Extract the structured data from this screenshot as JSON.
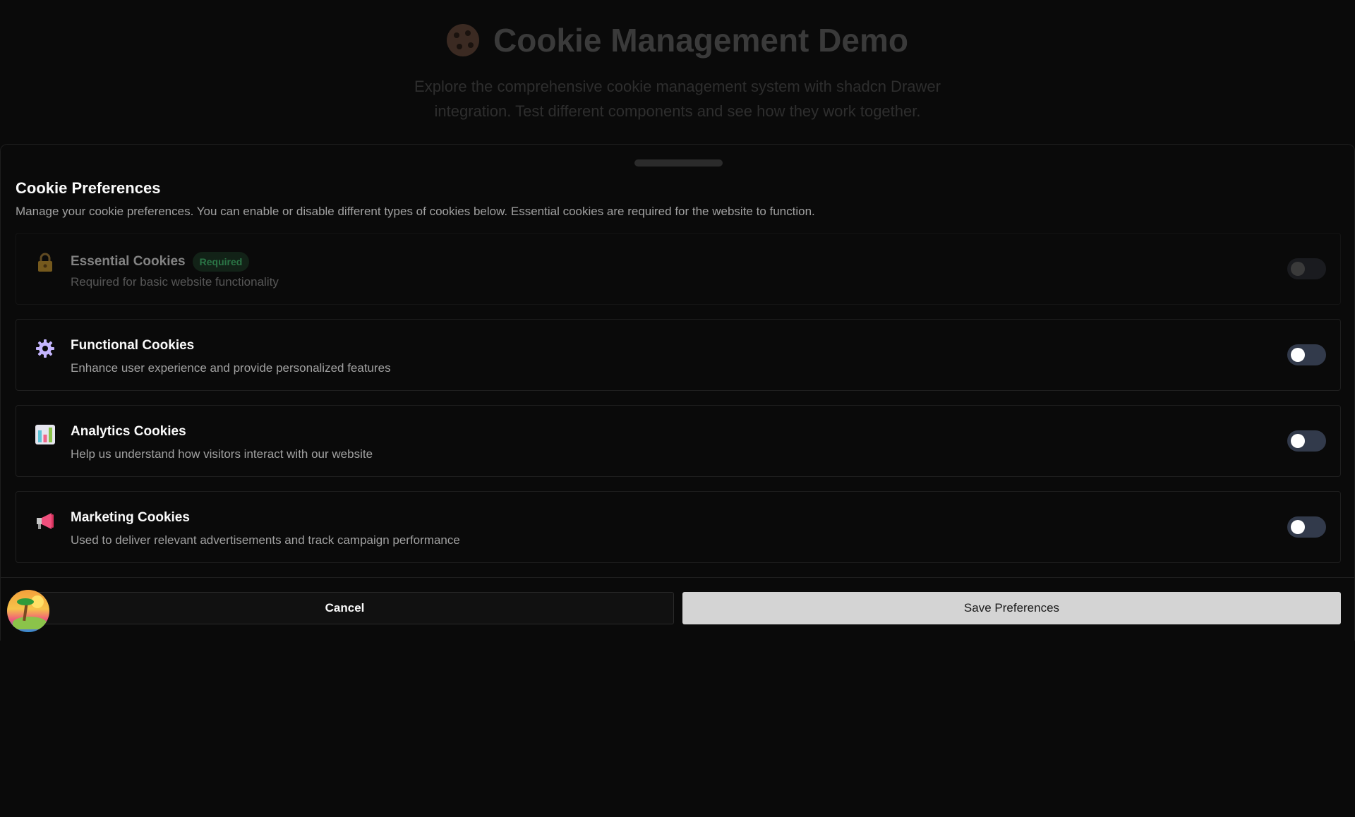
{
  "background": {
    "title": "Cookie Management Demo",
    "title_icon": "cookie-icon",
    "subtitle_line1": "Explore the comprehensive cookie management system with shadcn Drawer",
    "subtitle_line2": "integration. Test different components and see how they work together."
  },
  "drawer": {
    "title": "Cookie Preferences",
    "description": "Manage your cookie preferences. You can enable or disable different types of cookies below. Essential cookies are required for the website to function.",
    "categories": [
      {
        "name": "Essential Cookies",
        "badge": "Required",
        "description": "Required for basic website functionality",
        "icon": "lock-icon",
        "enabled": true,
        "disabled": true
      },
      {
        "name": "Functional Cookies",
        "description": "Enhance user experience and provide personalized features",
        "icon": "gear-icon",
        "enabled": false,
        "disabled": false
      },
      {
        "name": "Analytics Cookies",
        "description": "Help us understand how visitors interact with our website",
        "icon": "bar-chart-icon",
        "enabled": false,
        "disabled": false
      },
      {
        "name": "Marketing Cookies",
        "description": "Used to deliver relevant advertisements and track campaign performance",
        "icon": "megaphone-icon",
        "enabled": false,
        "disabled": false
      }
    ],
    "cancel_label": "Cancel",
    "save_label": "Save Preferences"
  },
  "user": {
    "avatar": "island-avatar-icon"
  }
}
